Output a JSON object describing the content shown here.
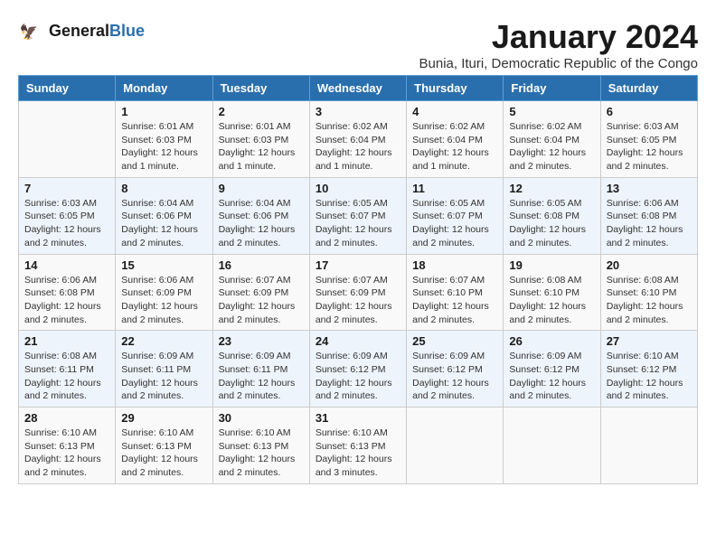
{
  "header": {
    "logo_line1": "General",
    "logo_line2": "Blue",
    "title": "January 2024",
    "subtitle": "Bunia, Ituri, Democratic Republic of the Congo"
  },
  "days_of_week": [
    "Sunday",
    "Monday",
    "Tuesday",
    "Wednesday",
    "Thursday",
    "Friday",
    "Saturday"
  ],
  "weeks": [
    [
      {
        "day": "",
        "info": ""
      },
      {
        "day": "1",
        "info": "Sunrise: 6:01 AM\nSunset: 6:03 PM\nDaylight: 12 hours\nand 1 minute."
      },
      {
        "day": "2",
        "info": "Sunrise: 6:01 AM\nSunset: 6:03 PM\nDaylight: 12 hours\nand 1 minute."
      },
      {
        "day": "3",
        "info": "Sunrise: 6:02 AM\nSunset: 6:04 PM\nDaylight: 12 hours\nand 1 minute."
      },
      {
        "day": "4",
        "info": "Sunrise: 6:02 AM\nSunset: 6:04 PM\nDaylight: 12 hours\nand 1 minute."
      },
      {
        "day": "5",
        "info": "Sunrise: 6:02 AM\nSunset: 6:04 PM\nDaylight: 12 hours\nand 2 minutes."
      },
      {
        "day": "6",
        "info": "Sunrise: 6:03 AM\nSunset: 6:05 PM\nDaylight: 12 hours\nand 2 minutes."
      }
    ],
    [
      {
        "day": "7",
        "info": "Sunrise: 6:03 AM\nSunset: 6:05 PM\nDaylight: 12 hours\nand 2 minutes."
      },
      {
        "day": "8",
        "info": "Sunrise: 6:04 AM\nSunset: 6:06 PM\nDaylight: 12 hours\nand 2 minutes."
      },
      {
        "day": "9",
        "info": "Sunrise: 6:04 AM\nSunset: 6:06 PM\nDaylight: 12 hours\nand 2 minutes."
      },
      {
        "day": "10",
        "info": "Sunrise: 6:05 AM\nSunset: 6:07 PM\nDaylight: 12 hours\nand 2 minutes."
      },
      {
        "day": "11",
        "info": "Sunrise: 6:05 AM\nSunset: 6:07 PM\nDaylight: 12 hours\nand 2 minutes."
      },
      {
        "day": "12",
        "info": "Sunrise: 6:05 AM\nSunset: 6:08 PM\nDaylight: 12 hours\nand 2 minutes."
      },
      {
        "day": "13",
        "info": "Sunrise: 6:06 AM\nSunset: 6:08 PM\nDaylight: 12 hours\nand 2 minutes."
      }
    ],
    [
      {
        "day": "14",
        "info": "Sunrise: 6:06 AM\nSunset: 6:08 PM\nDaylight: 12 hours\nand 2 minutes."
      },
      {
        "day": "15",
        "info": "Sunrise: 6:06 AM\nSunset: 6:09 PM\nDaylight: 12 hours\nand 2 minutes."
      },
      {
        "day": "16",
        "info": "Sunrise: 6:07 AM\nSunset: 6:09 PM\nDaylight: 12 hours\nand 2 minutes."
      },
      {
        "day": "17",
        "info": "Sunrise: 6:07 AM\nSunset: 6:09 PM\nDaylight: 12 hours\nand 2 minutes."
      },
      {
        "day": "18",
        "info": "Sunrise: 6:07 AM\nSunset: 6:10 PM\nDaylight: 12 hours\nand 2 minutes."
      },
      {
        "day": "19",
        "info": "Sunrise: 6:08 AM\nSunset: 6:10 PM\nDaylight: 12 hours\nand 2 minutes."
      },
      {
        "day": "20",
        "info": "Sunrise: 6:08 AM\nSunset: 6:10 PM\nDaylight: 12 hours\nand 2 minutes."
      }
    ],
    [
      {
        "day": "21",
        "info": "Sunrise: 6:08 AM\nSunset: 6:11 PM\nDaylight: 12 hours\nand 2 minutes."
      },
      {
        "day": "22",
        "info": "Sunrise: 6:09 AM\nSunset: 6:11 PM\nDaylight: 12 hours\nand 2 minutes."
      },
      {
        "day": "23",
        "info": "Sunrise: 6:09 AM\nSunset: 6:11 PM\nDaylight: 12 hours\nand 2 minutes."
      },
      {
        "day": "24",
        "info": "Sunrise: 6:09 AM\nSunset: 6:12 PM\nDaylight: 12 hours\nand 2 minutes."
      },
      {
        "day": "25",
        "info": "Sunrise: 6:09 AM\nSunset: 6:12 PM\nDaylight: 12 hours\nand 2 minutes."
      },
      {
        "day": "26",
        "info": "Sunrise: 6:09 AM\nSunset: 6:12 PM\nDaylight: 12 hours\nand 2 minutes."
      },
      {
        "day": "27",
        "info": "Sunrise: 6:10 AM\nSunset: 6:12 PM\nDaylight: 12 hours\nand 2 minutes."
      }
    ],
    [
      {
        "day": "28",
        "info": "Sunrise: 6:10 AM\nSunset: 6:13 PM\nDaylight: 12 hours\nand 2 minutes."
      },
      {
        "day": "29",
        "info": "Sunrise: 6:10 AM\nSunset: 6:13 PM\nDaylight: 12 hours\nand 2 minutes."
      },
      {
        "day": "30",
        "info": "Sunrise: 6:10 AM\nSunset: 6:13 PM\nDaylight: 12 hours\nand 2 minutes."
      },
      {
        "day": "31",
        "info": "Sunrise: 6:10 AM\nSunset: 6:13 PM\nDaylight: 12 hours\nand 3 minutes."
      },
      {
        "day": "",
        "info": ""
      },
      {
        "day": "",
        "info": ""
      },
      {
        "day": "",
        "info": ""
      }
    ]
  ]
}
